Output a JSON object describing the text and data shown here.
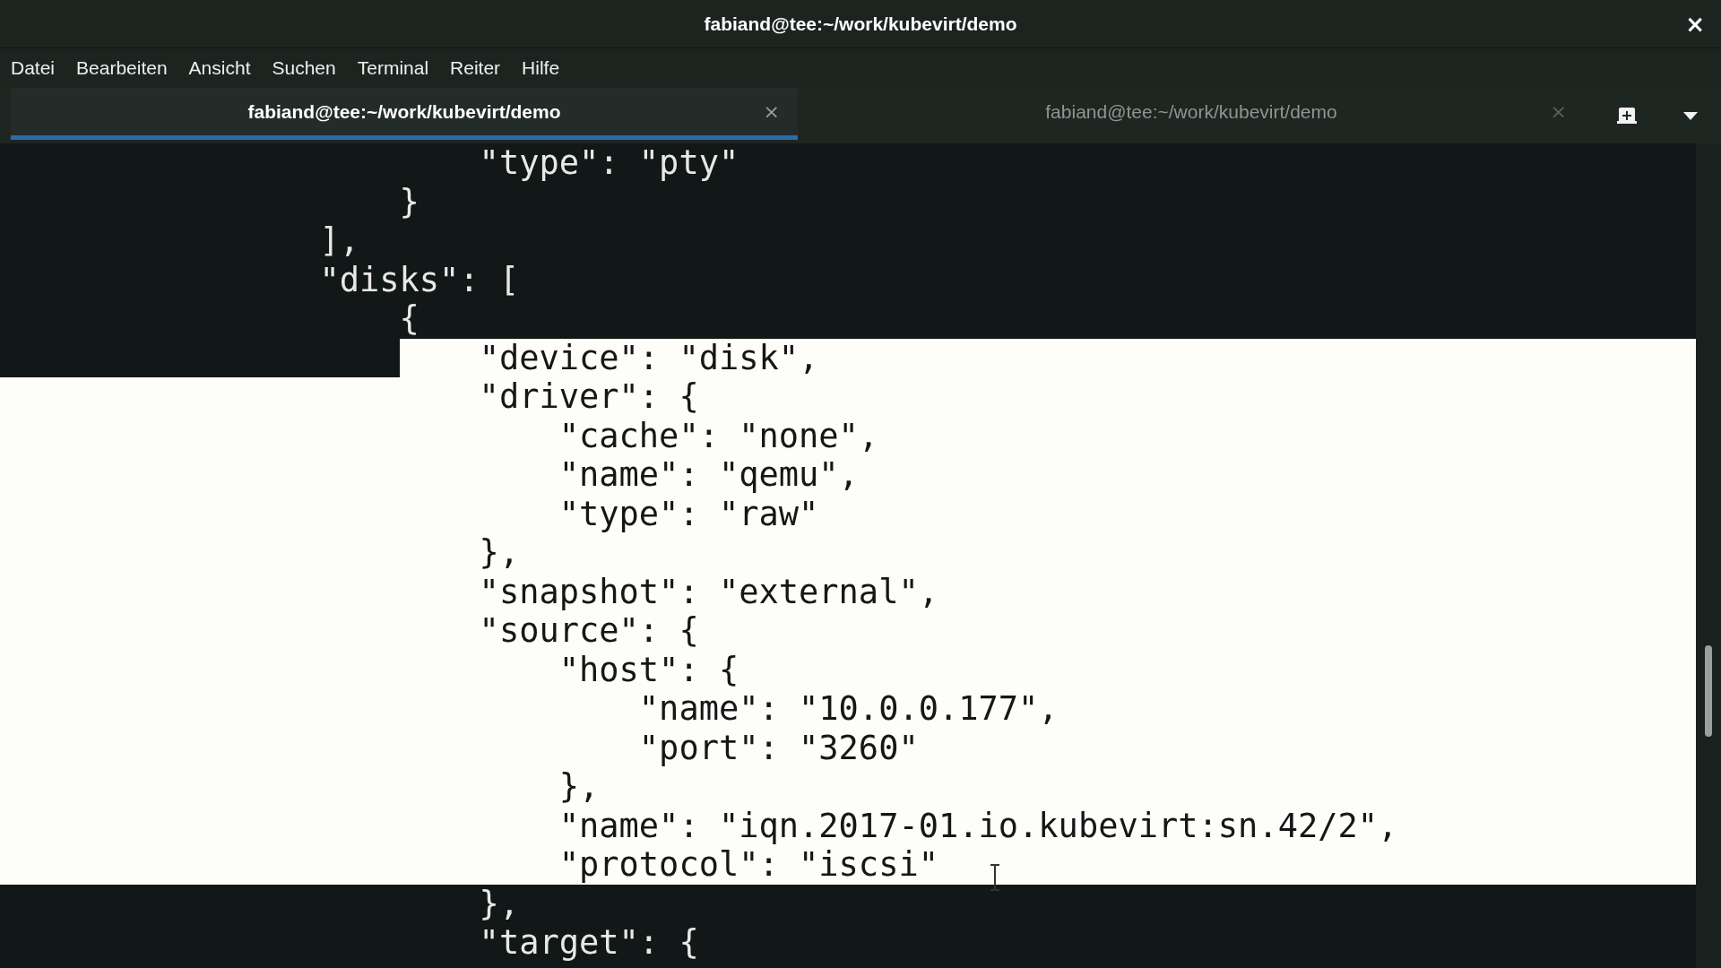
{
  "window": {
    "title": "fabiand@tee:~/work/kubevirt/demo",
    "close": "×"
  },
  "menu": [
    "Datei",
    "Bearbeiten",
    "Ansicht",
    "Suchen",
    "Terminal",
    "Reiter",
    "Hilfe"
  ],
  "tabs": [
    {
      "label": "fabiand@tee:~/work/kubevirt/demo",
      "close": "×",
      "selected": true
    },
    {
      "label": "fabiand@tee:~/work/kubevirt/demo",
      "close": "×",
      "selected": false
    }
  ],
  "terminal": {
    "lines": [
      {
        "text": "                        \"type\": \"pty\"",
        "selected": false
      },
      {
        "text": "                    }",
        "selected": false
      },
      {
        "text": "                ],",
        "selected": false
      },
      {
        "text": "                \"disks\": [",
        "selected": false
      },
      {
        "text": "                    {",
        "selected": false
      },
      {
        "text": "                        \"device\": \"disk\",",
        "selected": true
      },
      {
        "text": "                        \"driver\": {",
        "selected": true
      },
      {
        "text": "                            \"cache\": \"none\",",
        "selected": true
      },
      {
        "text": "                            \"name\": \"qemu\",",
        "selected": true
      },
      {
        "text": "                            \"type\": \"raw\"",
        "selected": true
      },
      {
        "text": "                        },",
        "selected": true
      },
      {
        "text": "                        \"snapshot\": \"external\",",
        "selected": true
      },
      {
        "text": "                        \"source\": {",
        "selected": true
      },
      {
        "text": "                            \"host\": {",
        "selected": true
      },
      {
        "text": "                                \"name\": \"10.0.0.177\",",
        "selected": true
      },
      {
        "text": "                                \"port\": \"3260\"",
        "selected": true
      },
      {
        "text": "                            },",
        "selected": true
      },
      {
        "text": "                            \"name\": \"iqn.2017-01.io.kubevirt:sn.42/2\",",
        "selected": true
      },
      {
        "text": "                            \"protocol\": \"iscsi\"",
        "selected": true
      },
      {
        "text": "                        },",
        "selected": false
      },
      {
        "text": "                        \"target\": {",
        "selected": false
      }
    ]
  }
}
